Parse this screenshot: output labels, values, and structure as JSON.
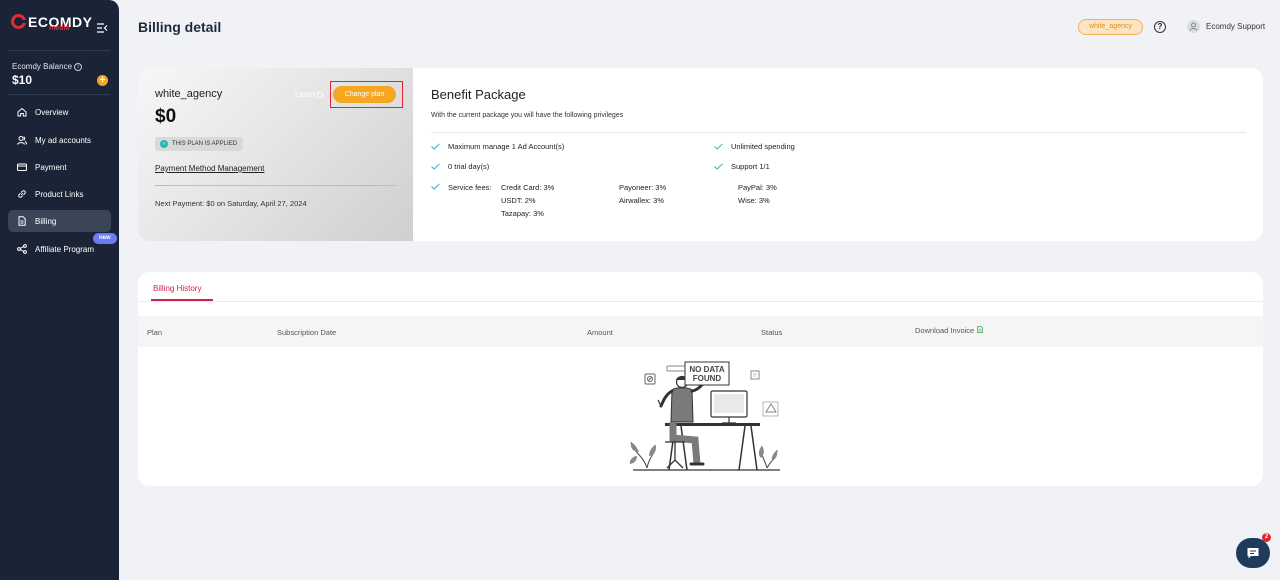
{
  "sidebar": {
    "logo_text": "ECOMDY",
    "logo_sub": "media",
    "balance_label": "Ecomdy Balance",
    "balance_value": "$10",
    "add_symbol": "+",
    "nav": [
      {
        "label": "Overview",
        "icon": "home-icon"
      },
      {
        "label": "My ad accounts",
        "icon": "users-icon"
      },
      {
        "label": "Payment",
        "icon": "card-icon"
      },
      {
        "label": "Product Links",
        "icon": "link-icon"
      },
      {
        "label": "Billing",
        "icon": "document-icon",
        "active": true
      },
      {
        "label": "Affiliate Program",
        "icon": "share-icon"
      }
    ],
    "new_badge": "new"
  },
  "header": {
    "title": "Billing detail",
    "agency_pill": "white_agency",
    "help_symbol": "?",
    "user_name": "Ecomdy Support"
  },
  "plan": {
    "name": "white_agency",
    "price": "$0",
    "applied_label": "THIS PLAN IS APPLIED",
    "learn_label": "Learn",
    "change_plan_label": "Change plan",
    "payment_mgmt_label": "Payment Method Management",
    "next_payment": "Next Payment: $0 on Saturday, April 27, 2024"
  },
  "benefits": {
    "title": "Benefit Package",
    "subtitle": "With the current package you will have the following privileges",
    "items": [
      "Maximum manage 1 Ad Account(s)",
      "0 trial day(s)",
      "Unlimited spending",
      "Support 1/1"
    ],
    "service_fees_label": "Service fees:",
    "fees": [
      "Credit Card: 3%",
      "Payoneer: 3%",
      "PayPal: 3%",
      "USDT: 2%",
      "Airwallex: 3%",
      "Wise: 3%",
      "Tazapay: 3%"
    ]
  },
  "history": {
    "tab_label": "Billing History",
    "columns": [
      "Plan",
      "Subscription Date",
      "Amount",
      "Status",
      "Download Invoice"
    ],
    "empty_text_1": "NO DATA",
    "empty_text_2": "FOUND"
  },
  "chat": {
    "badge_count": "2"
  },
  "colors": {
    "sidebar_bg": "#1b2436",
    "accent_orange": "#f5a623",
    "brand_red": "#e22a3b",
    "tab_active": "#d3204a",
    "check_teal": "#2bb5c2"
  }
}
